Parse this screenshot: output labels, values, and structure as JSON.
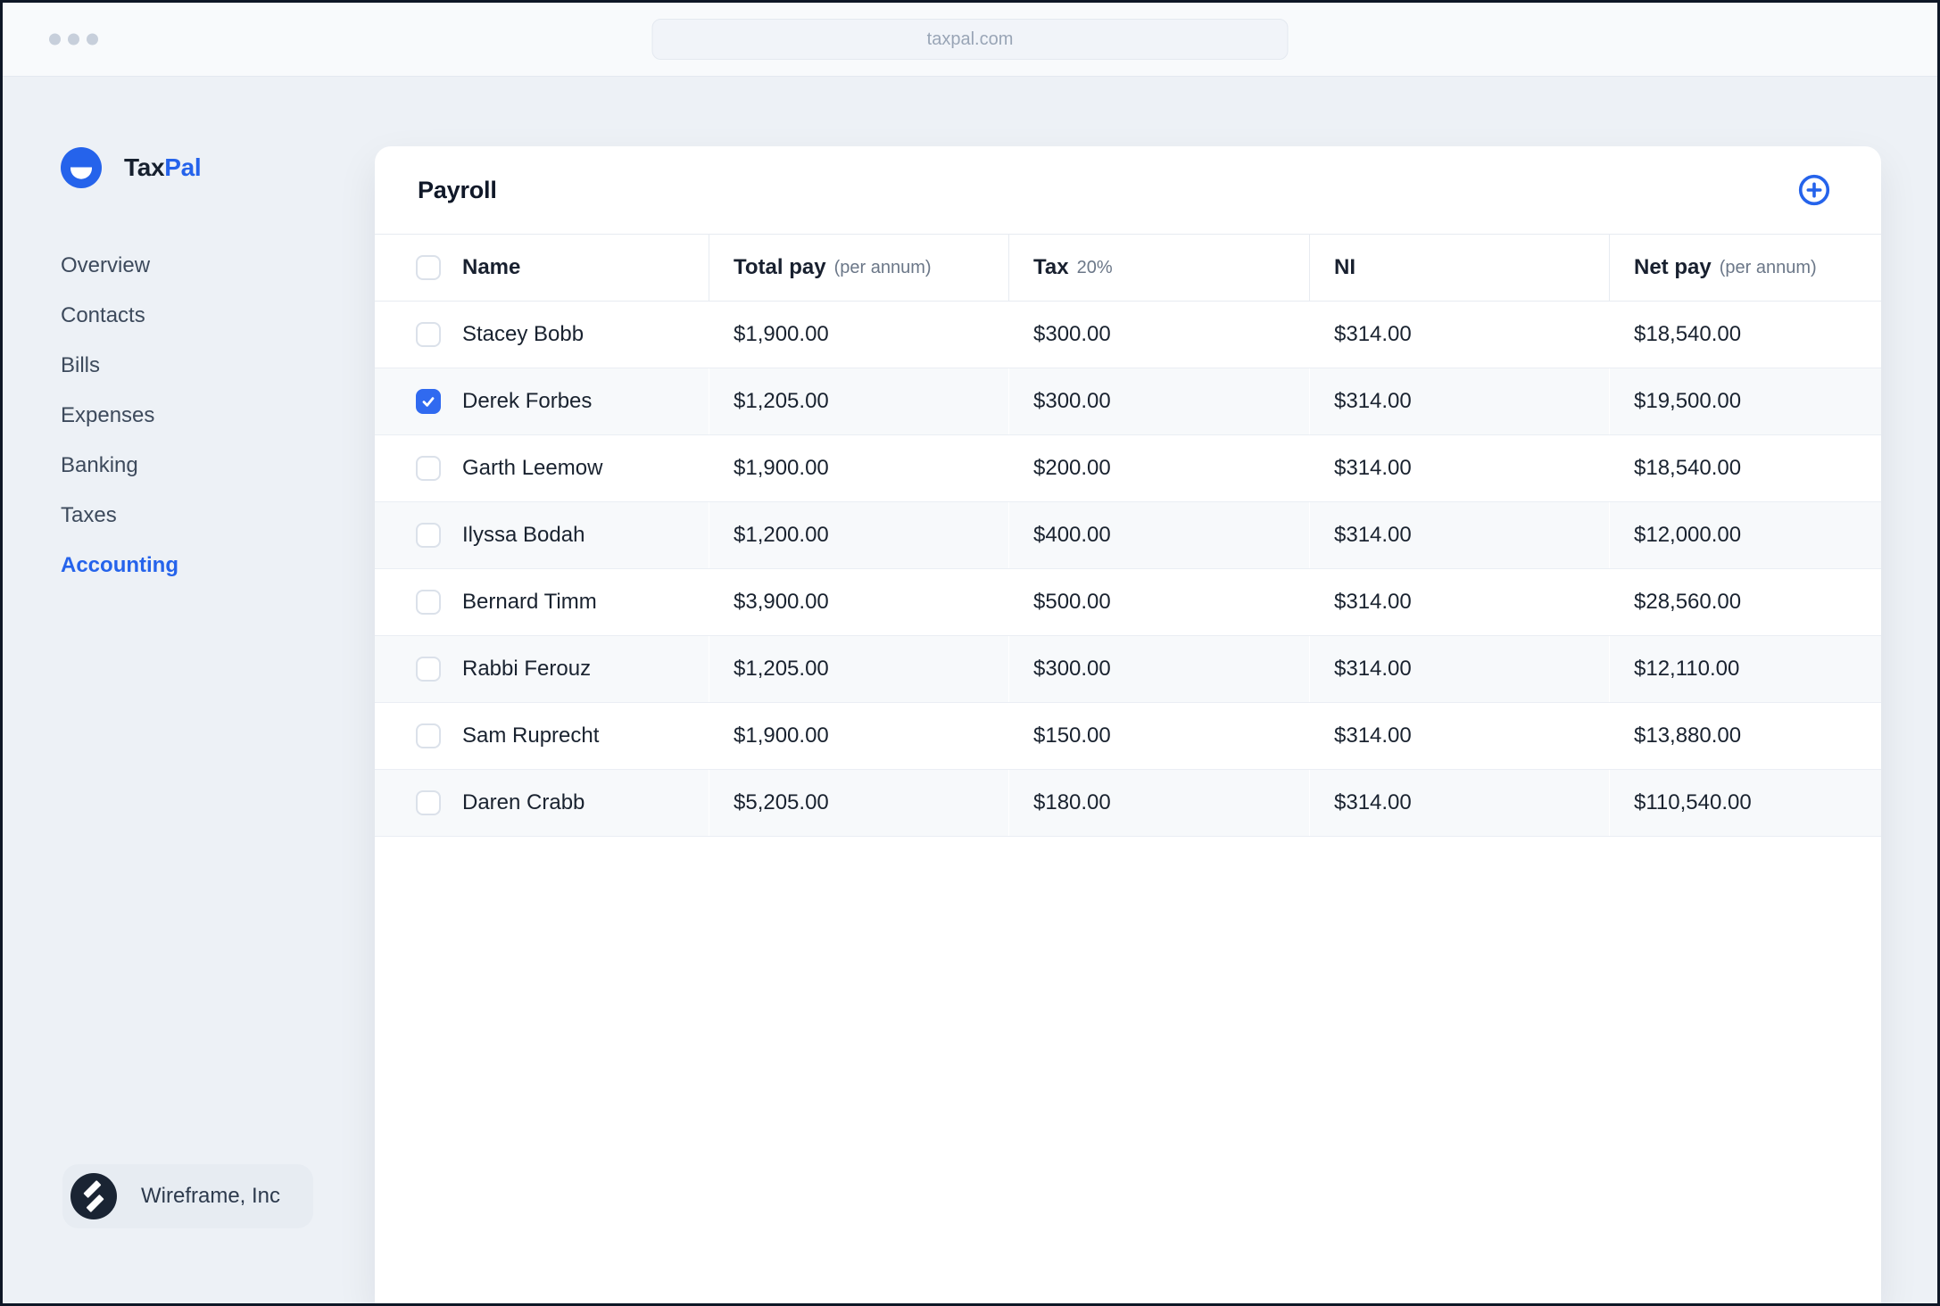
{
  "browser": {
    "url": "taxpal.com"
  },
  "sidebar": {
    "logo": {
      "primary": "Tax",
      "accent": "Pal"
    },
    "items": [
      {
        "label": "Overview",
        "active": false
      },
      {
        "label": "Contacts",
        "active": false
      },
      {
        "label": "Bills",
        "active": false
      },
      {
        "label": "Expenses",
        "active": false
      },
      {
        "label": "Banking",
        "active": false
      },
      {
        "label": "Taxes",
        "active": false
      },
      {
        "label": "Accounting",
        "active": true
      }
    ],
    "footer": {
      "company": "Wireframe, Inc"
    }
  },
  "main": {
    "title": "Payroll",
    "table": {
      "columns": [
        {
          "label": "Name",
          "sub": ""
        },
        {
          "label": "Total pay",
          "sub": "(per annum)"
        },
        {
          "label": "Tax",
          "sub": "20%"
        },
        {
          "label": "NI",
          "sub": ""
        },
        {
          "label": "Net pay",
          "sub": "(per annum)"
        }
      ],
      "rows": [
        {
          "name": "Stacey Bobb",
          "total_pay": "$1,900.00",
          "tax": "$300.00",
          "ni": "$314.00",
          "net_pay": "$18,540.00",
          "checked": false
        },
        {
          "name": "Derek Forbes",
          "total_pay": "$1,205.00",
          "tax": "$300.00",
          "ni": "$314.00",
          "net_pay": "$19,500.00",
          "checked": true
        },
        {
          "name": "Garth Leemow",
          "total_pay": "$1,900.00",
          "tax": "$200.00",
          "ni": "$314.00",
          "net_pay": "$18,540.00",
          "checked": false
        },
        {
          "name": "Ilyssa Bodah",
          "total_pay": "$1,200.00",
          "tax": "$400.00",
          "ni": "$314.00",
          "net_pay": "$12,000.00",
          "checked": false
        },
        {
          "name": "Bernard Timm",
          "total_pay": "$3,900.00",
          "tax": "$500.00",
          "ni": "$314.00",
          "net_pay": "$28,560.00",
          "checked": false
        },
        {
          "name": "Rabbi Ferouz",
          "total_pay": "$1,205.00",
          "tax": "$300.00",
          "ni": "$314.00",
          "net_pay": "$12,110.00",
          "checked": false
        },
        {
          "name": "Sam Ruprecht",
          "total_pay": "$1,900.00",
          "tax": "$150.00",
          "ni": "$314.00",
          "net_pay": "$13,880.00",
          "checked": false
        },
        {
          "name": "Daren Crabb",
          "total_pay": "$5,205.00",
          "tax": "$180.00",
          "ni": "$314.00",
          "net_pay": "$110,540.00",
          "checked": false
        }
      ]
    }
  },
  "colors": {
    "accent": "#2563eb",
    "checkbox_checked": "#306af0",
    "text_dark": "#101828",
    "text_muted": "#6b7788",
    "page_bg": "#edf1f6",
    "card_bg": "#ffffff",
    "row_alt_bg": "#f7f9fb",
    "border": "#e7ebf1",
    "frame_border": "#0e1726"
  }
}
